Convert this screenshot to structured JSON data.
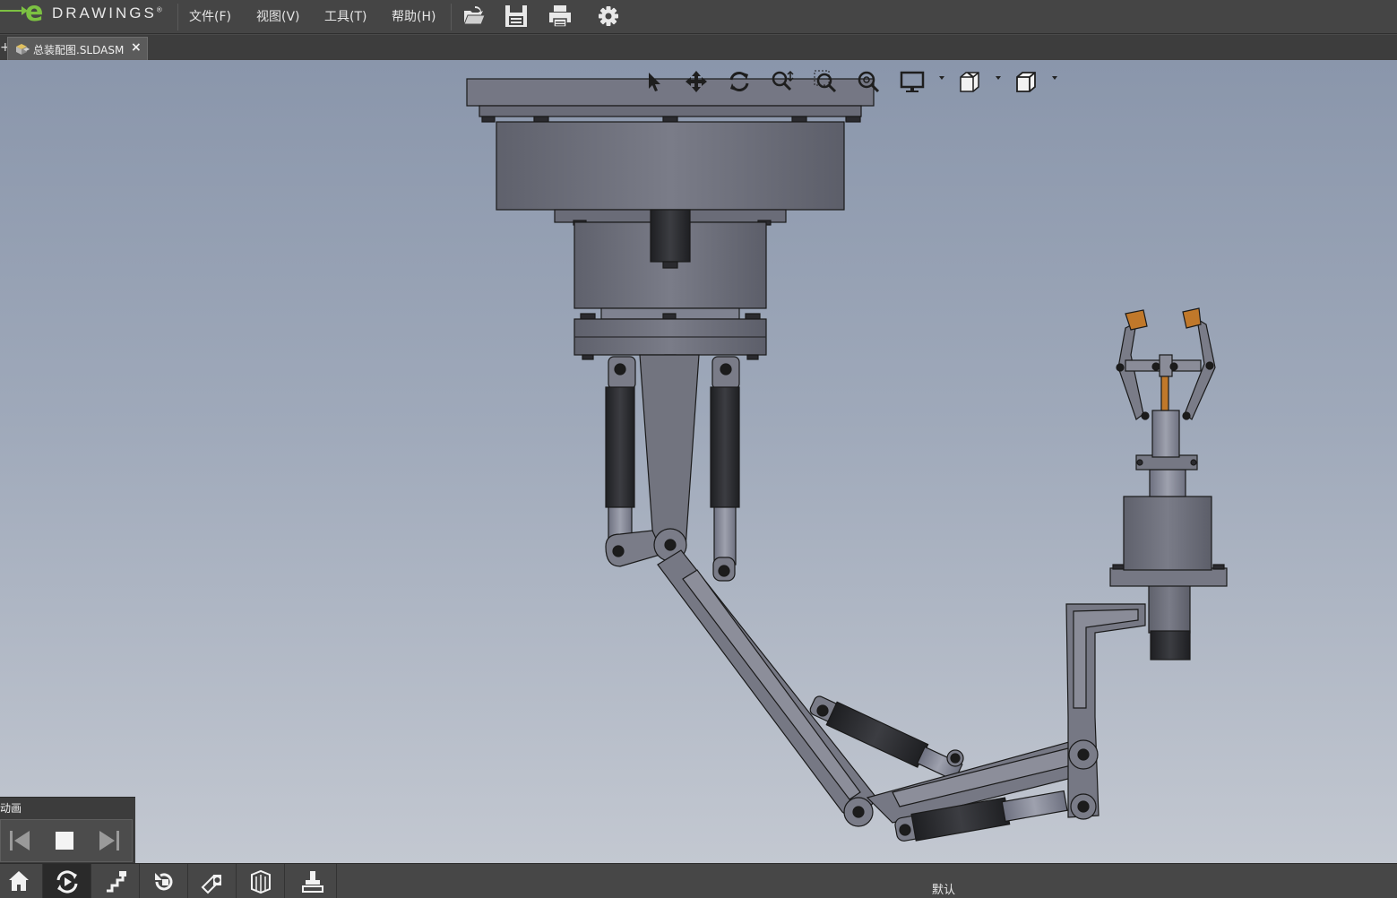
{
  "app": {
    "logo_letter": "e",
    "logo_word": "DRAWINGS",
    "logo_mark": "®"
  },
  "menu": {
    "file": "文件(F)",
    "view": "视图(V)",
    "tools": "工具(T)",
    "help": "帮助(H)"
  },
  "toolbar": {
    "icons": [
      "open-folder-icon",
      "save-icon",
      "print-icon",
      "settings-gear-icon"
    ]
  },
  "tabs": [
    {
      "label": "总装配图.SLDASM",
      "icon": "assembly-icon",
      "close": "×"
    }
  ],
  "view_toolbar": {
    "icons": [
      "select-arrow-icon",
      "pan-icon",
      "rotate-icon",
      "zoom-to-fit-icon",
      "zoom-to-area-icon",
      "zoom-icon",
      "display-style-icon",
      "section-view-icon",
      "standard-views-icon"
    ]
  },
  "animation": {
    "title": "动画",
    "controls": [
      "previous-frame-icon",
      "stop-icon",
      "next-frame-icon"
    ]
  },
  "bottom_toolbar": {
    "icons": [
      "home-icon",
      "animate-icon",
      "steps-icon",
      "rotate-model-icon",
      "measure-icon",
      "components-icon",
      "markup-stamp-icon"
    ],
    "active_index": 1
  },
  "status": {
    "configuration": "默认"
  },
  "colors": {
    "logo_green": "#7cc142",
    "part_gray": "#70727e",
    "cylinder_dark": "#2e2f33",
    "gripper_tip": "#c0782a"
  }
}
